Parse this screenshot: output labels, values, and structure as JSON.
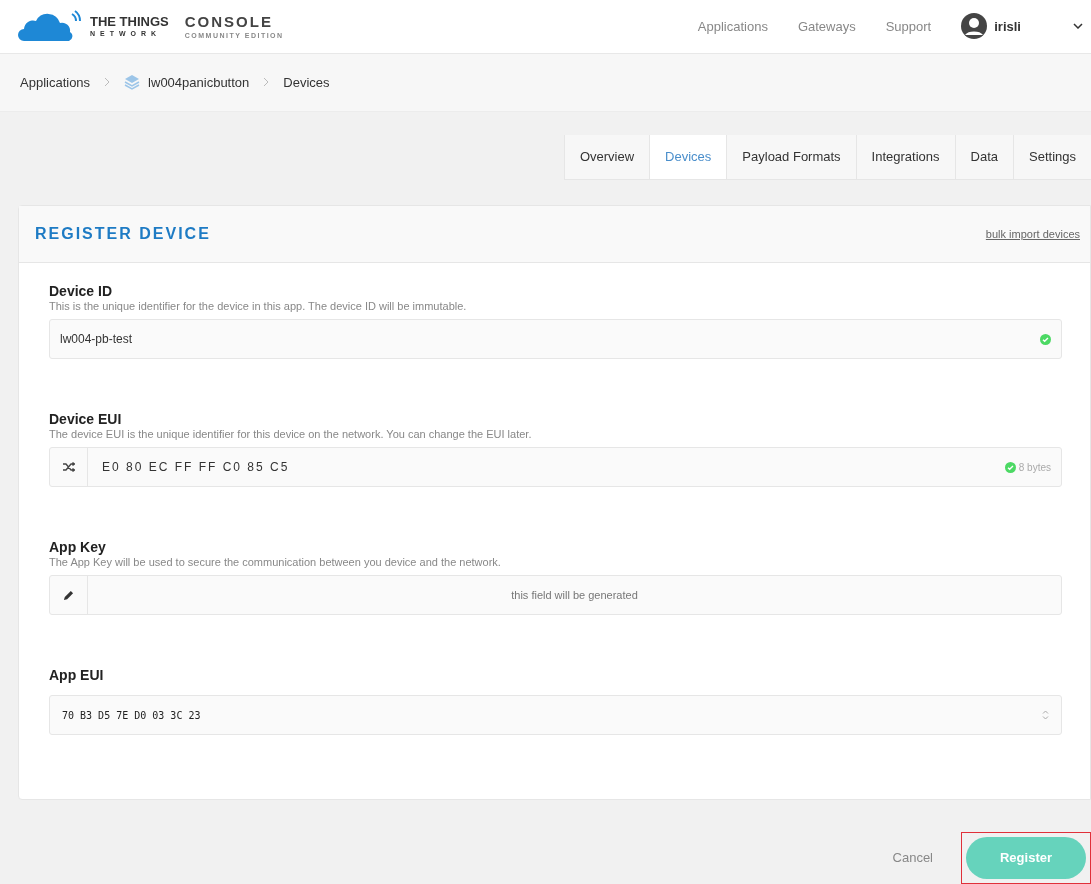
{
  "header": {
    "logo_title": "THE THINGS",
    "logo_subtitle": "NETWORK",
    "product": "CONSOLE",
    "edition": "COMMUNITY EDITION",
    "nav": [
      "Applications",
      "Gateways",
      "Support"
    ],
    "user": "irisli"
  },
  "breadcrumb": [
    {
      "label": "Applications",
      "kind": "link"
    },
    {
      "label": "lw004panicbutton",
      "kind": "app"
    },
    {
      "label": "Devices",
      "kind": "current"
    }
  ],
  "tabs": [
    {
      "label": "Overview",
      "selected": false
    },
    {
      "label": "Devices",
      "selected": true
    },
    {
      "label": "Payload Formats",
      "selected": false
    },
    {
      "label": "Integrations",
      "selected": false
    },
    {
      "label": "Data",
      "selected": false
    },
    {
      "label": "Settings",
      "selected": false
    }
  ],
  "card": {
    "title": "REGISTER DEVICE",
    "link": "bulk import devices"
  },
  "fields": [
    {
      "kind": "text",
      "label": "Device ID",
      "description": "This is the unique identifier for the device in this app. The device ID will be immutable.",
      "value": "lw004-pb-test",
      "valid": true
    },
    {
      "kind": "eui",
      "label": "Device EUI",
      "description": "The device EUI is the unique identifier for this device on the network. You can change the EUI later.",
      "value": "E0 80 EC FF FF C0 85 C5",
      "valid": true,
      "badge": "8 bytes"
    },
    {
      "kind": "generated",
      "label": "App Key",
      "description": "The App Key will be used to secure the communication between you device and the network.",
      "placeholder": "this field will be generated"
    },
    {
      "kind": "select",
      "label": "App EUI",
      "value": "70 B3 D5 7E D0 03 3C 23"
    }
  ],
  "actions": {
    "cancel": "Cancel",
    "submit": "Register",
    "submit_highlighted": true
  }
}
